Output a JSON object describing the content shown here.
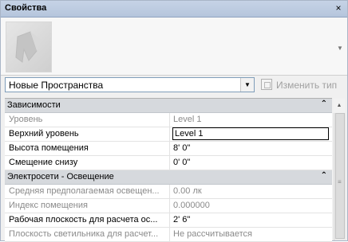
{
  "window": {
    "title": "Свойства",
    "close_glyph": "×"
  },
  "type_selector": {
    "value": "Новые Пространства",
    "edit_type_label": "Изменить тип"
  },
  "sections": [
    {
      "title": "Зависимости",
      "rows": [
        {
          "name": "Уровень",
          "value": "Level 1",
          "readonly": true
        },
        {
          "name": "Верхний уровень",
          "value": "Level 1",
          "readonly": false,
          "editing": true
        },
        {
          "name": "Высота помещения",
          "value": "8'  0\"",
          "readonly": false
        },
        {
          "name": "Смещение снизу",
          "value": "0'  0\"",
          "readonly": false
        }
      ]
    },
    {
      "title": "Электросети - Освещение",
      "rows": [
        {
          "name": "Средняя предполагаемая освещен...",
          "value": "0.00 лк",
          "readonly": true
        },
        {
          "name": "Индекс помещения",
          "value": "0.000000",
          "readonly": true
        },
        {
          "name": "Рабочая плоскость для расчета ос...",
          "value": "2'  6\"",
          "readonly": false
        },
        {
          "name": "Плоскость светильника для расчет...",
          "value": "Не рассчитывается",
          "readonly": true
        }
      ]
    }
  ],
  "icons": {
    "collapse": "collapse-icon",
    "dropdown": "chevron-down-icon",
    "edit_type": "edit-type-icon",
    "scroll_up": "scroll-up-icon"
  }
}
